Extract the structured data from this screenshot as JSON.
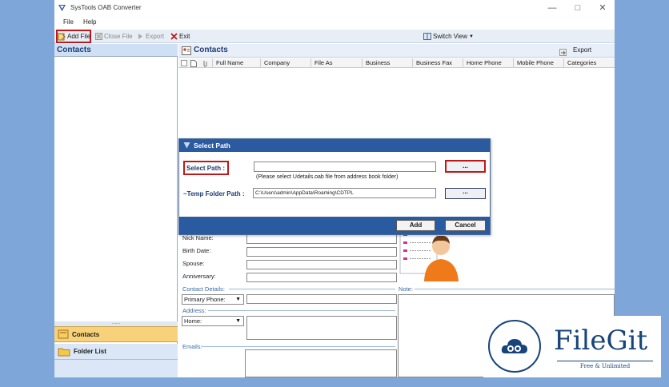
{
  "window": {
    "title": "SysTools OAB Converter"
  },
  "menu": [
    "File",
    "Help"
  ],
  "toolbar": {
    "add_file": "Add File",
    "close_file": "Close File",
    "export": "Export",
    "exit": "Exit",
    "switch_view": "Switch View"
  },
  "sidebar": {
    "header": "Contacts",
    "grip": "......",
    "nav": {
      "contacts": "Contacts",
      "folder_list": "Folder List"
    }
  },
  "main": {
    "header": "Contacts",
    "export": "Export",
    "columns": [
      "Full Name",
      "Company",
      "File As",
      "Business",
      "Business Fax",
      "Home Phone",
      "Mobile Phone",
      "Categories"
    ]
  },
  "details": {
    "nick_name": "Nick Name:",
    "birth_date": "Birth Date:",
    "spouse": "Spouse:",
    "anniversary": "Anniversary:",
    "contact_details": "Contact Details:",
    "primary_phone": "Primary Phone:",
    "address": "Address:",
    "home": "Home:",
    "emails": "Emails:",
    "note": "Note:"
  },
  "dialog": {
    "title": "Select Path",
    "select_path_label": "Select Path :",
    "select_path_value": "",
    "hint": "(Please select Udetails.oab file from address book folder)",
    "temp_folder_label": "~Temp Folder Path :",
    "temp_folder_value": "C:\\Users\\admin\\AppData\\Roaming\\CDTPL",
    "browse": "...",
    "add": "Add",
    "cancel": "Cancel"
  },
  "watermark": {
    "brand": "FileGit",
    "tagline": "Free & Unlimited"
  },
  "colors": {
    "dialog_blue": "#2a5aa0",
    "highlight_red": "#c01818",
    "nav_active": "#f7d27a",
    "brand": "#17447a"
  }
}
